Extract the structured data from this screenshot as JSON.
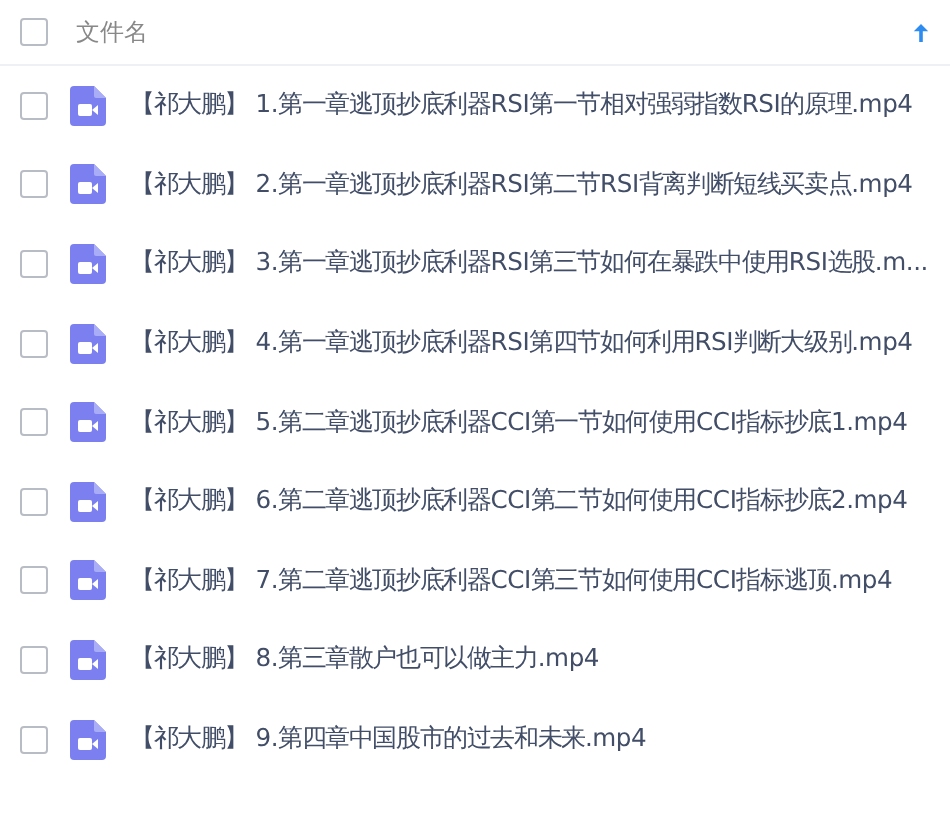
{
  "header": {
    "checked": false,
    "column": "文件名",
    "sort_ascending": true
  },
  "files": [
    {
      "tag": "【祁大鹏】",
      "name": "1.第一章逃顶抄底利器RSI第一节相对强弱指数RSI的原理.mp4",
      "checked": false
    },
    {
      "tag": "【祁大鹏】",
      "name": "2.第一章逃顶抄底利器RSI第二节RSI背离判断短线买卖点.mp4",
      "checked": false
    },
    {
      "tag": "【祁大鹏】",
      "name": "3.第一章逃顶抄底利器RSI第三节如何在暴跌中使用RSI选股.m...",
      "checked": false
    },
    {
      "tag": "【祁大鹏】",
      "name": "4.第一章逃顶抄底利器RSI第四节如何利用RSI判断大级别.mp4",
      "checked": false
    },
    {
      "tag": "【祁大鹏】",
      "name": "5.第二章逃顶抄底利器CCI第一节如何使用CCI指标抄底1.mp4",
      "checked": false
    },
    {
      "tag": "【祁大鹏】",
      "name": "6.第二章逃顶抄底利器CCI第二节如何使用CCI指标抄底2.mp4",
      "checked": false
    },
    {
      "tag": "【祁大鹏】",
      "name": "7.第二章逃顶抄底利器CCI第三节如何使用CCI指标逃顶.mp4",
      "checked": false
    },
    {
      "tag": "【祁大鹏】",
      "name": "8.第三章散户也可以做主力.mp4",
      "checked": false
    },
    {
      "tag": "【祁大鹏】",
      "name": "9.第四章中国股市的过去和未来.mp4",
      "checked": false
    }
  ]
}
